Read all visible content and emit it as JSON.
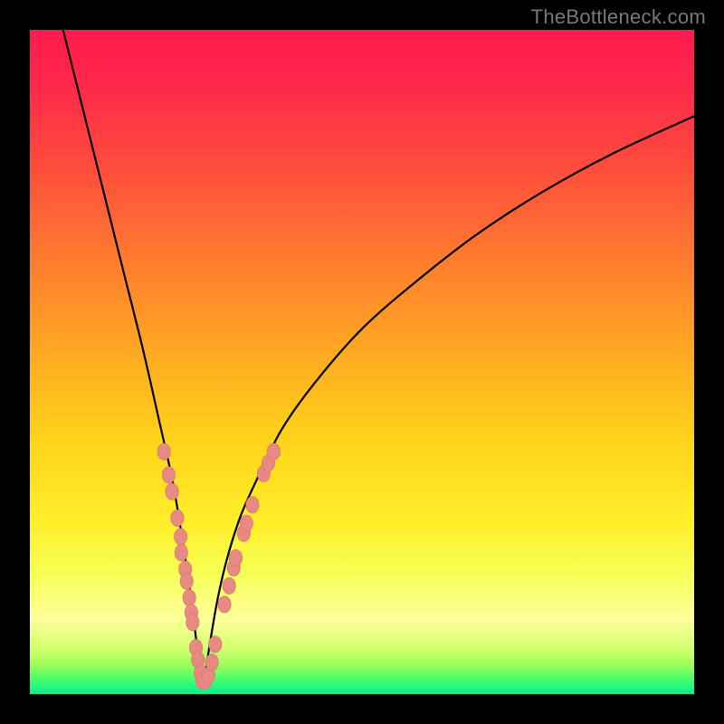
{
  "watermark": "TheBottleneck.com",
  "colors": {
    "frame_bg_stops": [
      {
        "offset": 0.0,
        "color": "#ff1a4d"
      },
      {
        "offset": 0.09,
        "color": "#ff2a49"
      },
      {
        "offset": 0.2,
        "color": "#ff4a3d"
      },
      {
        "offset": 0.34,
        "color": "#ff7a30"
      },
      {
        "offset": 0.48,
        "color": "#ffa722"
      },
      {
        "offset": 0.62,
        "color": "#ffd41a"
      },
      {
        "offset": 0.74,
        "color": "#ffee2a"
      },
      {
        "offset": 0.82,
        "color": "#f6ff55"
      },
      {
        "offset": 0.885,
        "color": "#ffff9a"
      },
      {
        "offset": 0.93,
        "color": "#d6ff72"
      },
      {
        "offset": 0.955,
        "color": "#9fff5a"
      },
      {
        "offset": 0.975,
        "color": "#53ff66"
      },
      {
        "offset": 0.99,
        "color": "#1dfb86"
      },
      {
        "offset": 1.0,
        "color": "#18e58c"
      }
    ],
    "curve": "#000000",
    "dot_fill": "#e78a84",
    "dot_stroke": "#d86f68"
  },
  "chart_data": {
    "type": "line",
    "title": "",
    "xlabel": "",
    "ylabel": "",
    "xlim": [
      0,
      100
    ],
    "ylim": [
      0,
      100
    ],
    "series": [
      {
        "name": "bottleneck-curve",
        "x": [
          5,
          8,
          11,
          14,
          17,
          19.5,
          21.5,
          23,
          24.2,
          25.0,
          25.6,
          25.9,
          26.1,
          26.5,
          27.2,
          28.3,
          29.8,
          31.8,
          34.5,
          38,
          43,
          50,
          58,
          67,
          77,
          88,
          100
        ],
        "y": [
          100,
          88,
          76,
          64,
          52,
          41,
          32,
          23,
          15,
          8.5,
          4.0,
          1.5,
          1.5,
          3.8,
          8.2,
          14.5,
          20.8,
          27,
          33,
          40,
          47,
          55,
          62,
          69,
          75.5,
          81.5,
          87
        ]
      }
    ],
    "data_markers": {
      "name": "sample-dots",
      "points": [
        {
          "x": 20.2,
          "y": 36.5
        },
        {
          "x": 20.9,
          "y": 33.0
        },
        {
          "x": 21.4,
          "y": 30.5
        },
        {
          "x": 22.2,
          "y": 26.5
        },
        {
          "x": 22.7,
          "y": 23.7
        },
        {
          "x": 22.8,
          "y": 21.3
        },
        {
          "x": 23.4,
          "y": 18.8
        },
        {
          "x": 23.6,
          "y": 17.0
        },
        {
          "x": 24.0,
          "y": 14.5
        },
        {
          "x": 24.3,
          "y": 12.3
        },
        {
          "x": 24.5,
          "y": 10.8
        },
        {
          "x": 25.0,
          "y": 7.0
        },
        {
          "x": 25.3,
          "y": 5.2
        },
        {
          "x": 25.7,
          "y": 3.2
        },
        {
          "x": 25.9,
          "y": 2.0
        },
        {
          "x": 26.4,
          "y": 2.0
        },
        {
          "x": 26.9,
          "y": 2.8
        },
        {
          "x": 27.4,
          "y": 4.8
        },
        {
          "x": 27.9,
          "y": 7.5
        },
        {
          "x": 29.3,
          "y": 13.5
        },
        {
          "x": 30.0,
          "y": 16.3
        },
        {
          "x": 30.7,
          "y": 19.0
        },
        {
          "x": 31.0,
          "y": 20.5
        },
        {
          "x": 32.2,
          "y": 24.2
        },
        {
          "x": 32.6,
          "y": 25.7
        },
        {
          "x": 33.5,
          "y": 28.5
        },
        {
          "x": 35.2,
          "y": 33.2
        },
        {
          "x": 35.9,
          "y": 34.8
        },
        {
          "x": 36.7,
          "y": 36.5
        }
      ]
    }
  }
}
